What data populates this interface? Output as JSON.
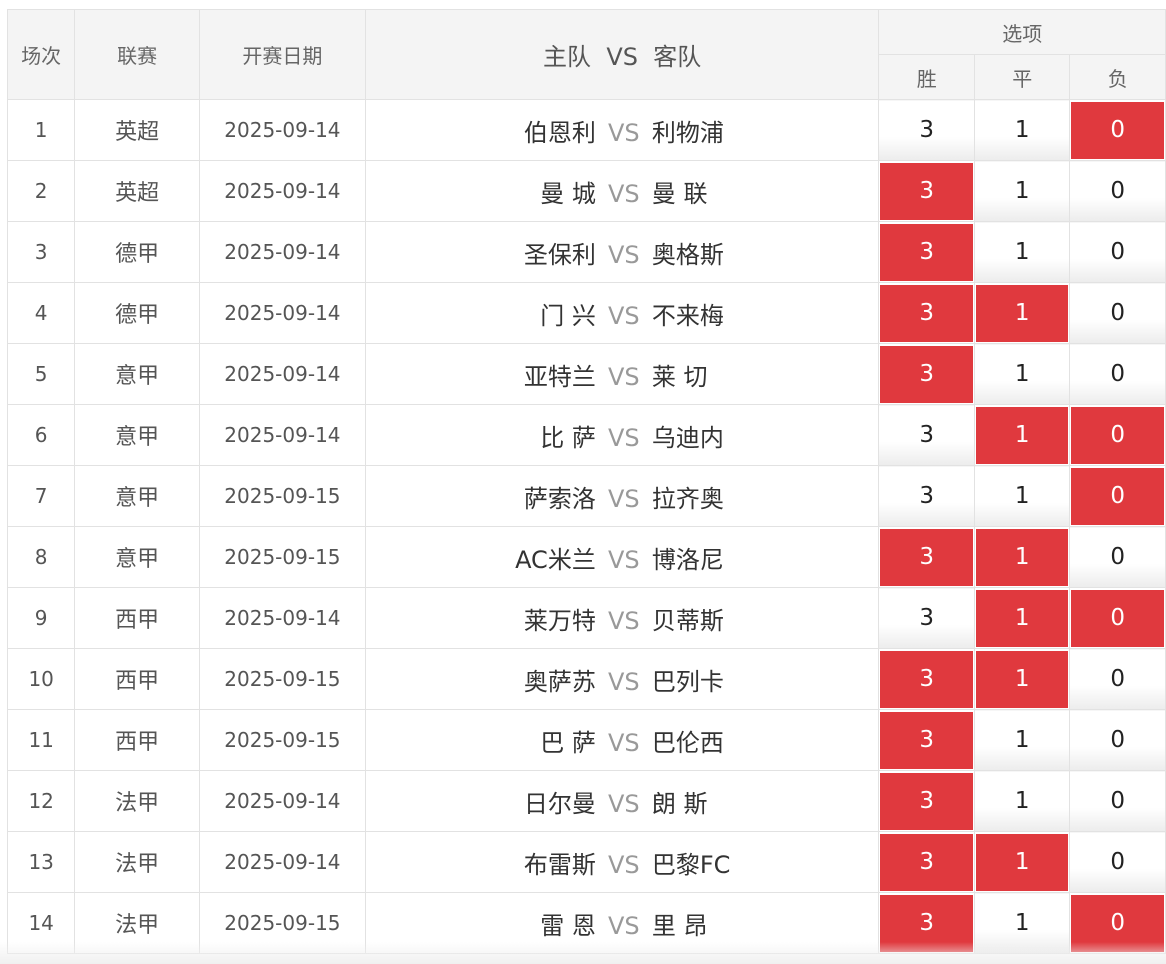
{
  "header": {
    "col_num": "场次",
    "col_league": "联赛",
    "col_date": "开赛日期",
    "col_home": "主队",
    "col_vs": "VS",
    "col_away": "客队",
    "options_title": "选项",
    "opt_win": "胜",
    "opt_draw": "平",
    "opt_lose": "负"
  },
  "colors": {
    "selected": "#e0393e",
    "header_bg": "#f4f4f4"
  },
  "rows": [
    {
      "num": "1",
      "league": "英超",
      "date": "2025-09-14",
      "home": "伯恩利",
      "vs": "VS",
      "away": "利物浦",
      "w": "3",
      "d": "1",
      "l": "0",
      "w_sel": false,
      "d_sel": false,
      "l_sel": true
    },
    {
      "num": "2",
      "league": "英超",
      "date": "2025-09-14",
      "home": "曼 城",
      "vs": "VS",
      "away": "曼 联",
      "w": "3",
      "d": "1",
      "l": "0",
      "w_sel": true,
      "d_sel": false,
      "l_sel": false
    },
    {
      "num": "3",
      "league": "德甲",
      "date": "2025-09-14",
      "home": "圣保利",
      "vs": "VS",
      "away": "奥格斯",
      "w": "3",
      "d": "1",
      "l": "0",
      "w_sel": true,
      "d_sel": false,
      "l_sel": false
    },
    {
      "num": "4",
      "league": "德甲",
      "date": "2025-09-14",
      "home": "门 兴",
      "vs": "VS",
      "away": "不来梅",
      "w": "3",
      "d": "1",
      "l": "0",
      "w_sel": true,
      "d_sel": true,
      "l_sel": false
    },
    {
      "num": "5",
      "league": "意甲",
      "date": "2025-09-14",
      "home": "亚特兰",
      "vs": "VS",
      "away": "莱 切",
      "w": "3",
      "d": "1",
      "l": "0",
      "w_sel": true,
      "d_sel": false,
      "l_sel": false
    },
    {
      "num": "6",
      "league": "意甲",
      "date": "2025-09-14",
      "home": "比 萨",
      "vs": "VS",
      "away": "乌迪内",
      "w": "3",
      "d": "1",
      "l": "0",
      "w_sel": false,
      "d_sel": true,
      "l_sel": true
    },
    {
      "num": "7",
      "league": "意甲",
      "date": "2025-09-15",
      "home": "萨索洛",
      "vs": "VS",
      "away": "拉齐奥",
      "w": "3",
      "d": "1",
      "l": "0",
      "w_sel": false,
      "d_sel": false,
      "l_sel": true
    },
    {
      "num": "8",
      "league": "意甲",
      "date": "2025-09-15",
      "home": "AC米兰",
      "vs": "VS",
      "away": "博洛尼",
      "w": "3",
      "d": "1",
      "l": "0",
      "w_sel": true,
      "d_sel": true,
      "l_sel": false
    },
    {
      "num": "9",
      "league": "西甲",
      "date": "2025-09-14",
      "home": "莱万特",
      "vs": "VS",
      "away": "贝蒂斯",
      "w": "3",
      "d": "1",
      "l": "0",
      "w_sel": false,
      "d_sel": true,
      "l_sel": true
    },
    {
      "num": "10",
      "league": "西甲",
      "date": "2025-09-15",
      "home": "奥萨苏",
      "vs": "VS",
      "away": "巴列卡",
      "w": "3",
      "d": "1",
      "l": "0",
      "w_sel": true,
      "d_sel": true,
      "l_sel": false
    },
    {
      "num": "11",
      "league": "西甲",
      "date": "2025-09-15",
      "home": "巴 萨",
      "vs": "VS",
      "away": "巴伦西",
      "w": "3",
      "d": "1",
      "l": "0",
      "w_sel": true,
      "d_sel": false,
      "l_sel": false
    },
    {
      "num": "12",
      "league": "法甲",
      "date": "2025-09-14",
      "home": "日尔曼",
      "vs": "VS",
      "away": "朗 斯",
      "w": "3",
      "d": "1",
      "l": "0",
      "w_sel": true,
      "d_sel": false,
      "l_sel": false
    },
    {
      "num": "13",
      "league": "法甲",
      "date": "2025-09-14",
      "home": "布雷斯",
      "vs": "VS",
      "away": "巴黎FC",
      "w": "3",
      "d": "1",
      "l": "0",
      "w_sel": true,
      "d_sel": true,
      "l_sel": false
    },
    {
      "num": "14",
      "league": "法甲",
      "date": "2025-09-15",
      "home": "雷 恩",
      "vs": "VS",
      "away": "里 昂",
      "w": "3",
      "d": "1",
      "l": "0",
      "w_sel": true,
      "d_sel": false,
      "l_sel": true
    }
  ]
}
